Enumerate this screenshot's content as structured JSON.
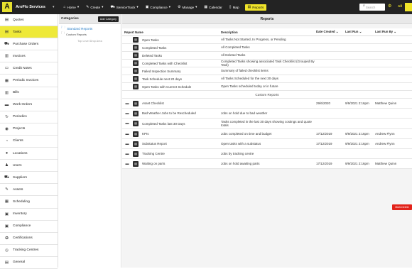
{
  "brand": {
    "logo": "A",
    "name": "AroFlo Services"
  },
  "nav": [
    {
      "icon": "home-icon",
      "glyph": "⌂",
      "label": "Home",
      "caret": "▾"
    },
    {
      "icon": "pencil-icon",
      "glyph": "✎",
      "label": "Create",
      "caret": "▾"
    },
    {
      "icon": "truck-icon",
      "glyph": "⛟",
      "label": "ServiceTrack",
      "caret": "▾"
    },
    {
      "icon": "compliance-icon",
      "glyph": "▣",
      "label": "Compliance",
      "caret": "▾"
    },
    {
      "icon": "gear-icon",
      "glyph": "⚙",
      "label": "Manage",
      "caret": "▾"
    },
    {
      "icon": "calendar-icon",
      "glyph": "▦",
      "label": "Calendar",
      "caret": ""
    },
    {
      "icon": "map-icon",
      "glyph": "▯",
      "label": "Map",
      "caret": ""
    },
    {
      "icon": "reports-icon",
      "glyph": "▤",
      "label": "Reports",
      "caret": ""
    }
  ],
  "search": {
    "placeholder": "Search"
  },
  "top_right": {
    "all_label": "All"
  },
  "sidebar": [
    {
      "icon": "quotes-icon",
      "glyph": "▤",
      "label": "Quotes"
    },
    {
      "icon": "tasks-icon",
      "glyph": "▤",
      "label": "Tasks"
    },
    {
      "icon": "cart-icon",
      "glyph": "⛟",
      "label": "Purchase Orders"
    },
    {
      "icon": "invoice-icon",
      "glyph": "▥",
      "label": "Invoices"
    },
    {
      "icon": "credit-icon",
      "glyph": "▭",
      "label": "Credit Notes"
    },
    {
      "icon": "periodic-invoice-icon",
      "glyph": "▦",
      "label": "Periodic Invoices"
    },
    {
      "icon": "bills-icon",
      "glyph": "▥",
      "label": "Bills"
    },
    {
      "icon": "briefcase-icon",
      "glyph": "▬",
      "label": "Work Orders"
    },
    {
      "icon": "refresh-icon",
      "glyph": "↻",
      "label": "Periodics"
    },
    {
      "icon": "projects-icon",
      "glyph": "◉",
      "label": "Projects"
    },
    {
      "icon": "clients-icon",
      "glyph": "◔",
      "label": "Clients"
    },
    {
      "icon": "location-icon",
      "glyph": "●",
      "label": "Locations"
    },
    {
      "icon": "user-icon",
      "glyph": "♟",
      "label": "Users"
    },
    {
      "icon": "truck-icon",
      "glyph": "⛟",
      "label": "Suppliers"
    },
    {
      "icon": "wrench-icon",
      "glyph": "✎",
      "label": "Assets"
    },
    {
      "icon": "calendar-icon",
      "glyph": "▦",
      "label": "Scheduling"
    },
    {
      "icon": "inventory-icon",
      "glyph": "▣",
      "label": "Inventory"
    },
    {
      "icon": "compliance-icon",
      "glyph": "▣",
      "label": "Compliance"
    },
    {
      "icon": "certificate-icon",
      "glyph": "✪",
      "label": "Certifications"
    },
    {
      "icon": "tracking-icon",
      "glyph": "◎",
      "label": "Tracking Centres"
    },
    {
      "icon": "general-icon",
      "glyph": "▤",
      "label": "General"
    }
  ],
  "categories": {
    "title": "Categories",
    "add_label": "Add Category",
    "standard": "Standard Reports",
    "custom": "Custom Reports",
    "drop": "Top Level Drop Area"
  },
  "reports": {
    "title": "Reports",
    "columns": {
      "name": "Report Name",
      "desc": "Description",
      "created": "Date Created",
      "lastrun": "Last Run",
      "lastby": "Last Run By",
      "sort": "⌄"
    },
    "standard": [
      {
        "name": "Open Tasks",
        "desc": "All Tasks Not Started, In Progress, or Pending"
      },
      {
        "name": "Completed Tasks",
        "desc": "All Completed Tasks"
      },
      {
        "name": "Deleted Tasks",
        "desc": "All Deleted Tasks"
      },
      {
        "name": "Completed Tasks with Checklist",
        "desc": "Completed Tasks showing associated Task Checklist (Grouped By Task)"
      },
      {
        "name": "Failed Inspection Summary",
        "desc": "Summary of failed checklist items"
      },
      {
        "name": "Task Schedule next 20 days",
        "desc": "All Tasks Scheduled for the next 30 days"
      },
      {
        "name": "Open Tasks with Current Schedule",
        "desc": "Open Tasks scheduled today or in future"
      }
    ],
    "custom_label": "Custom Reports",
    "custom": [
      {
        "name": "Asset Checklist",
        "desc": "",
        "created": "29/6/2020",
        "lastrun": "9/9/2021 2:16pm",
        "by": "Matthew Quinn"
      },
      {
        "name": "Bad Weather Jobs to be Rescheduled",
        "desc": "Jobs on hold due to bad weather",
        "created": "",
        "lastrun": "",
        "by": ""
      },
      {
        "name": "Completed Tasks last 30 Days",
        "desc": "Tasks completed in the last 30 days showing costings and quote totals",
        "created": "",
        "lastrun": "",
        "by": ""
      },
      {
        "name": "KPIs",
        "desc": "Jobs completed on time and budget",
        "created": "17/12/2019",
        "lastrun": "9/9/2021 2:16pm",
        "by": "Andrew Flynn"
      },
      {
        "name": "Substatus Report",
        "desc": "Open tasks with a substatus",
        "created": "17/12/2019",
        "lastrun": "9/9/2021 2:16pm",
        "by": "Andrew Flynn"
      },
      {
        "name": "Tracking Centre",
        "desc": "Jobs by tracking centre",
        "created": "",
        "lastrun": "",
        "by": ""
      },
      {
        "name": "Waiting on parts",
        "desc": "Jobs on hold awaiting parts",
        "created": "17/12/2019",
        "lastrun": "9/9/2021 2:16pm",
        "by": "Matthew Quinn"
      }
    ],
    "multi_delete": "Multi-Delete"
  }
}
